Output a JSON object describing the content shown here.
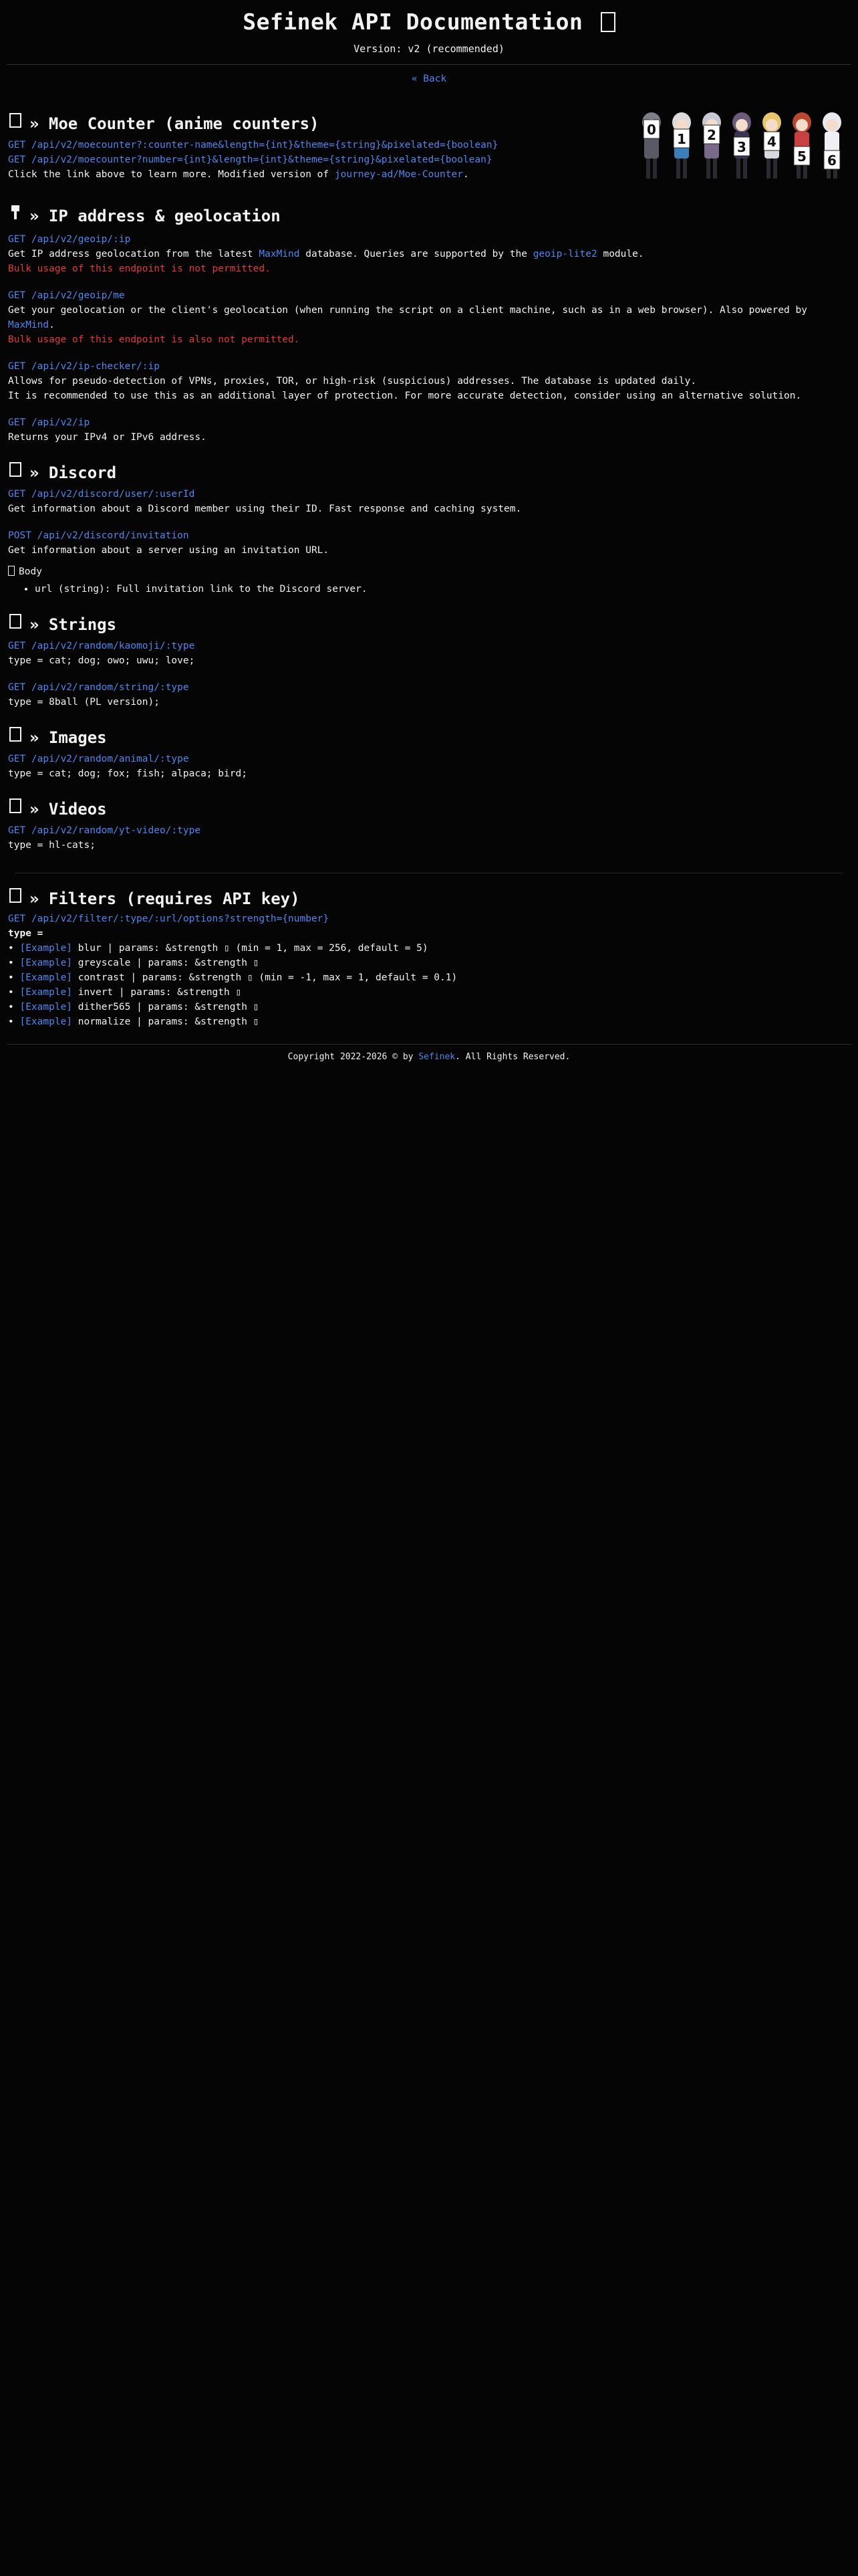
{
  "header": {
    "title": "Sefinek API Documentation",
    "title_icon": "book-icon",
    "version": "Version: v2 (recommended)",
    "back_link": "« Back"
  },
  "moe": {
    "heading": "» Moe Counter (anime counters)",
    "icon": "number-counter-icon",
    "endpoints": [
      "GET /api/v2/moecounter?:counter-name&length={int}&theme={string}&pixelated={boolean}",
      "GET /api/v2/moecounter?number={int}&length={int}&theme={string}&pixelated={boolean}"
    ],
    "desc_before": "Click the link above to learn more. Modified version of ",
    "desc_link": "journey-ad/Moe-Counter",
    "desc_after": ".",
    "counter_digits": [
      "0",
      "1",
      "2",
      "3",
      "4",
      "5",
      "6"
    ]
  },
  "ip": {
    "heading": "» IP address & geolocation",
    "icon": "pin-icon",
    "geoip": {
      "endpoint": "GET /api/v2/geoip/:ip",
      "desc_1": "Get IP address geolocation from the latest ",
      "link_1": "MaxMind",
      "desc_2": " database. Queries are supported by the ",
      "link_2": "geoip-lite2",
      "desc_3": " module.",
      "warning": "Bulk usage of this endpoint is not permitted."
    },
    "geoip_me": {
      "endpoint": "GET /api/v2/geoip/me",
      "desc_1": "Get your geolocation or the client's geolocation (when running the script on a client machine, such as in a web browser). Also powered by ",
      "link_1": "MaxMind",
      "desc_2": ".",
      "warning": "Bulk usage of this endpoint is also not permitted."
    },
    "ip_checker": {
      "endpoint": "GET /api/v2/ip-checker/:ip",
      "desc_1": "Allows for pseudo-detection of VPNs, proxies, TOR, or high-risk (suspicious) addresses. The database is updated daily.",
      "desc_2": "It is recommended to use this as an additional layer of protection. For more accurate detection, consider using an alternative solution."
    },
    "ip_own": {
      "endpoint": "GET /api/v2/ip",
      "desc": "Returns your IPv4 or IPv6 address."
    }
  },
  "discord": {
    "heading": "» Discord",
    "icon": "discord-icon",
    "user": {
      "endpoint": "GET /api/v2/discord/user/:userId",
      "desc": "Get information about a Discord member using their ID. Fast response and caching system."
    },
    "invitation": {
      "endpoint": "POST /api/v2/discord/invitation",
      "desc": "Get information about a server using an invitation URL.",
      "body_label": "Body",
      "body_icon": "body-icon",
      "body_item": "url (string): Full invitation link to the Discord server."
    }
  },
  "strings": {
    "heading": "» Strings",
    "icon": "text-icon",
    "kaomoji": {
      "endpoint": "GET /api/v2/random/kaomoji/:type",
      "types": "type = cat; dog; owo; uwu; love;"
    },
    "string": {
      "endpoint": "GET /api/v2/random/string/:type",
      "types": "type = 8ball (PL version);"
    }
  },
  "images": {
    "heading": "» Images",
    "icon": "image-icon",
    "animal": {
      "endpoint": "GET /api/v2/random/animal/:type",
      "types": "type = cat; dog; fox; fish; alpaca; bird;"
    }
  },
  "videos": {
    "heading": "» Videos",
    "icon": "video-icon",
    "yt": {
      "endpoint": "GET /api/v2/random/yt-video/:type",
      "types": "type = hl-cats;"
    }
  },
  "filters": {
    "heading": "» Filters (requires API key)",
    "icon": "filter-icon",
    "endpoint": "GET /api/v2/filter/:type/:url/options?strength={number}",
    "type_label": "type =",
    "example_label": "[Example]",
    "items": [
      {
        "text": " blur | params: &strength ▯ (min = 1, max = 256, default = 5)"
      },
      {
        "text": " greyscale | params: &strength ▯"
      },
      {
        "text": " contrast | params: &strength ▯ (min = -1, max = 1, default = 0.1)"
      },
      {
        "text": " invert | params: &strength ▯"
      },
      {
        "text": " dither565 | params: &strength ▯"
      },
      {
        "text": " normalize | params: &strength ▯"
      }
    ]
  },
  "footer": {
    "before": "Copyright 2022-2026 © by ",
    "link": "Sefinek",
    "after": ". All Rights Reserved."
  }
}
